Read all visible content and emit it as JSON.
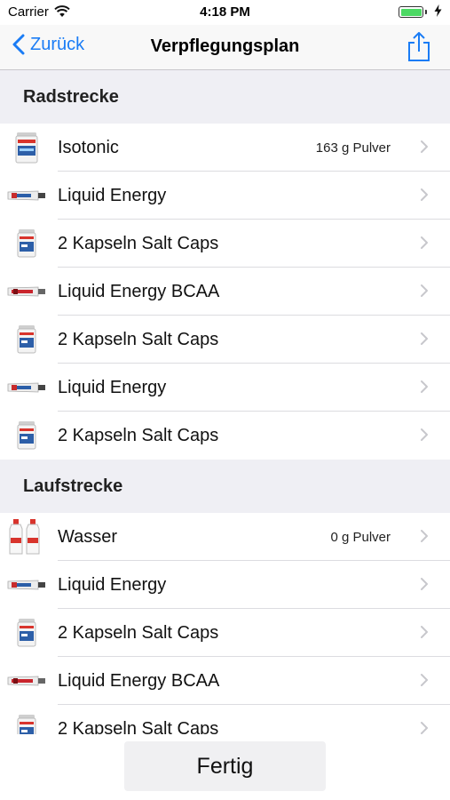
{
  "status_bar": {
    "carrier": "Carrier",
    "time": "4:18 PM",
    "battery_level": 1.0,
    "battery_color": "#4cd964"
  },
  "nav": {
    "back_label": "Zurück",
    "title": "Verpflegungsplan",
    "share_icon": "share-icon",
    "accent_color": "#1a7cf5"
  },
  "sections": [
    {
      "title": "Radstrecke",
      "items": [
        {
          "icon": "powder-can-icon",
          "label": "Isotonic",
          "detail": "163 g Pulver"
        },
        {
          "icon": "gel-tube-blue-icon",
          "label": "Liquid Energy",
          "detail": ""
        },
        {
          "icon": "capsule-can-icon",
          "label": "2 Kapseln Salt Caps",
          "detail": ""
        },
        {
          "icon": "gel-tube-red-icon",
          "label": "Liquid Energy BCAA",
          "detail": ""
        },
        {
          "icon": "capsule-can-icon",
          "label": "2 Kapseln Salt Caps",
          "detail": ""
        },
        {
          "icon": "gel-tube-blue-icon",
          "label": "Liquid Energy",
          "detail": ""
        },
        {
          "icon": "capsule-can-icon",
          "label": "2 Kapseln Salt Caps",
          "detail": ""
        }
      ]
    },
    {
      "title": "Laufstrecke",
      "items": [
        {
          "icon": "water-bottles-icon",
          "label": "Wasser",
          "detail": "0 g Pulver"
        },
        {
          "icon": "gel-tube-blue-icon",
          "label": "Liquid Energy",
          "detail": ""
        },
        {
          "icon": "capsule-can-icon",
          "label": "2 Kapseln Salt Caps",
          "detail": ""
        },
        {
          "icon": "gel-tube-red-icon",
          "label": "Liquid Energy BCAA",
          "detail": ""
        },
        {
          "icon": "capsule-can-icon",
          "label": "2 Kapseln Salt Caps",
          "detail": ""
        }
      ]
    }
  ],
  "footer": {
    "done_label": "Fertig"
  }
}
